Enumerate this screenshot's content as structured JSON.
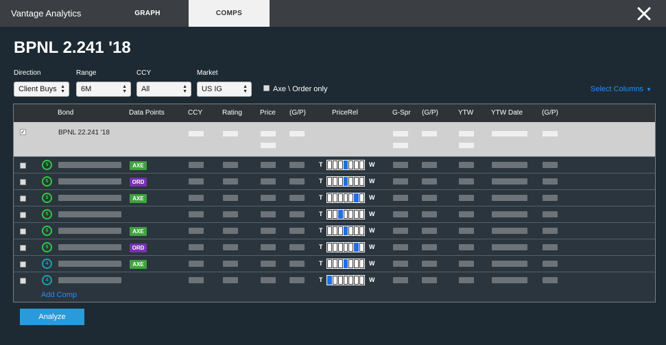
{
  "header": {
    "app_title": "Vantage Analytics",
    "tabs": [
      {
        "label": "GRAPH",
        "active": false
      },
      {
        "label": "COMPS",
        "active": true
      }
    ],
    "close_icon": "close-icon"
  },
  "page_title": "BPNL 2.241 '18",
  "filters": {
    "direction": {
      "label": "Direction",
      "value": "Client Buys"
    },
    "range": {
      "label": "Range",
      "value": "6M"
    },
    "ccy": {
      "label": "CCY",
      "value": "All"
    },
    "market": {
      "label": "Market",
      "value": "US IG"
    },
    "axe_order": {
      "label": "Axe \\ Order only",
      "checked": false
    },
    "select_columns": "Select Columns"
  },
  "columns": [
    "Bond",
    "Data Points",
    "CCY",
    "Rating",
    "Price",
    "(G/P)",
    "PriceRel",
    "G-Spr",
    "(G/P)",
    "YTW",
    "YTW Date",
    "(G/P)"
  ],
  "reference_row": {
    "bond": "BPNL 22.241 '18",
    "checked": true
  },
  "pricerel_labels": {
    "left": "T",
    "right": "W"
  },
  "rows": [
    {
      "rating": "5",
      "rating_color": "#2ecc40",
      "tag": "AXE",
      "pricerel_pos": 3
    },
    {
      "rating": "5",
      "rating_color": "#2ecc40",
      "tag": "ORD",
      "pricerel_pos": 3
    },
    {
      "rating": "5",
      "rating_color": "#2ecc40",
      "tag": "AXE",
      "pricerel_pos": 5
    },
    {
      "rating": "5",
      "rating_color": "#2ecc40",
      "tag": "",
      "pricerel_pos": 2
    },
    {
      "rating": "5",
      "rating_color": "#2ecc40",
      "tag": "AXE",
      "pricerel_pos": 3
    },
    {
      "rating": "5",
      "rating_color": "#2ecc40",
      "tag": "ORD",
      "pricerel_pos": 5
    },
    {
      "rating": "4",
      "rating_color": "#17a2b8",
      "tag": "AXE",
      "pricerel_pos": 3
    },
    {
      "rating": "4",
      "rating_color": "#17a2b8",
      "tag": "",
      "pricerel_pos": 0
    }
  ],
  "tag_colors": {
    "AXE": "#3fa33f",
    "ORD": "#7a2fb5"
  },
  "add_comp": "Add Comp",
  "analyze_button": "Analyze"
}
